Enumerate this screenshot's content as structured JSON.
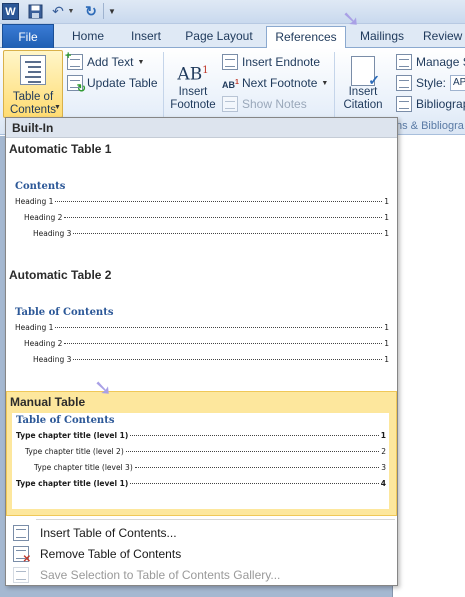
{
  "app": {
    "logo_letter": "W"
  },
  "tabs": [
    {
      "label": "File"
    },
    {
      "label": "Home"
    },
    {
      "label": "Insert"
    },
    {
      "label": "Page Layout"
    },
    {
      "label": "References"
    },
    {
      "label": "Mailings"
    },
    {
      "label": "Review"
    }
  ],
  "ribbon": {
    "toc_label_line1": "Table of",
    "toc_label_line2": "Contents",
    "add_text": "Add Text",
    "update_table": "Update Table",
    "insert_footnote_line1": "Insert",
    "insert_footnote_line2": "Footnote",
    "footnote_icon_text": "AB",
    "footnote_icon_sup": "1",
    "insert_endnote": "Insert Endnote",
    "next_footnote": "Next Footnote",
    "show_notes": "Show Notes",
    "insert_citation_line1": "Insert",
    "insert_citation_line2": "Citation",
    "manage_sources": "Manage S",
    "style_label": "Style:",
    "style_value": "APA",
    "bibliography": "Bibliograp",
    "group_label": "ns & Bibliogra"
  },
  "gallery": {
    "section_header": "Built-In",
    "auto1": {
      "title": "Automatic Table 1",
      "sample_heading": "Contents",
      "rows": [
        {
          "label": "Heading 1",
          "page": "1"
        },
        {
          "label": "Heading 2",
          "page": "1"
        },
        {
          "label": "Heading 3",
          "page": "1"
        }
      ]
    },
    "auto2": {
      "title": "Automatic Table 2",
      "sample_heading": "Table of Contents",
      "rows": [
        {
          "label": "Heading 1",
          "page": "1"
        },
        {
          "label": "Heading 2",
          "page": "1"
        },
        {
          "label": "Heading 3",
          "page": "1"
        }
      ]
    },
    "manual": {
      "title": "Manual Table",
      "sample_heading": "Table of Contents",
      "rows": [
        {
          "label": "Type chapter title (level 1)",
          "page": "1"
        },
        {
          "label": "Type chapter title (level 2)",
          "page": "2"
        },
        {
          "label": "Type chapter title (level 3)",
          "page": "3"
        },
        {
          "label": "Type chapter title (level 1)",
          "page": "4"
        }
      ]
    },
    "menu": {
      "insert_toc": "Insert Table of Contents...",
      "remove_toc": "Remove Table of Contents",
      "save_selection": "Save Selection to Table of Contents Gallery..."
    }
  },
  "colors": {
    "accent": "#2b5797",
    "selected_highlight": "#fde79d",
    "annotation_arrow": "#a9a0e6"
  }
}
